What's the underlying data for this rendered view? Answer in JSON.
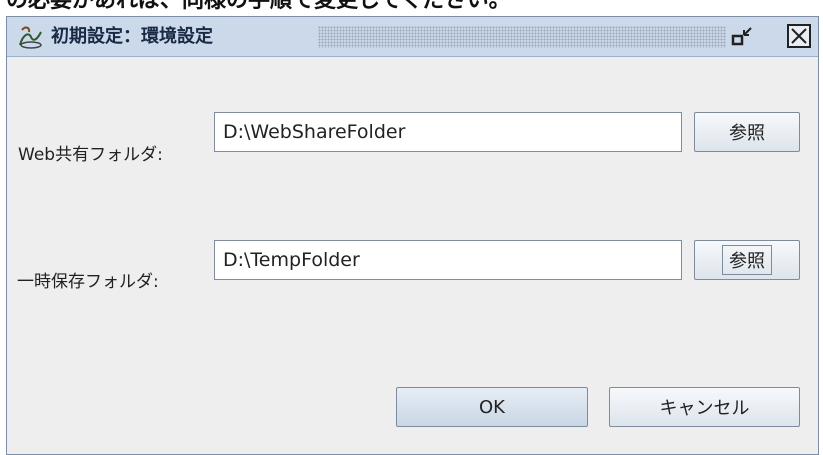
{
  "top_text": "の必要があれば、同様の手順で変更してください。",
  "window": {
    "title": "初期設定：環境設定",
    "restore_icon": "restore-icon",
    "close_icon": "close-icon"
  },
  "form": {
    "web_folder_label": "Web共有フォルダ:",
    "web_folder_value": "D:\\WebShareFolder",
    "web_browse_label": "参照",
    "temp_folder_label": "一時保存フォルダ:",
    "temp_folder_value": "D:\\TempFolder",
    "temp_browse_label": "参照"
  },
  "footer": {
    "ok_label": "OK",
    "cancel_label": "キャンセル"
  },
  "colors": {
    "titlebar": "#cbd9ea",
    "dialog_bg": "#eeeeee",
    "border": "#7c8ea6"
  }
}
